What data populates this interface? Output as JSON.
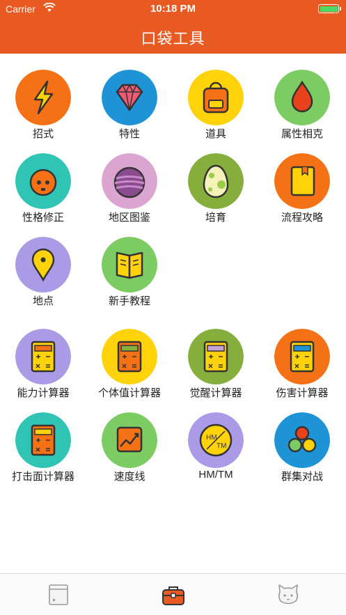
{
  "status_bar": {
    "carrier": "Carrier",
    "time": "10:18 PM"
  },
  "header": {
    "title": "口袋工具"
  },
  "grid": [
    {
      "label": "招式",
      "icon": "lightning-icon",
      "color": "#f57115"
    },
    {
      "label": "特性",
      "icon": "gem-icon",
      "color": "#1e94d6"
    },
    {
      "label": "道具",
      "icon": "backpack-icon",
      "color": "#ffd20a"
    },
    {
      "label": "属性相克",
      "icon": "drop-icon",
      "color": "#7ccb63"
    },
    {
      "label": "性格修正",
      "icon": "face-icon",
      "color": "#30c4b5"
    },
    {
      "label": "地区图鉴",
      "icon": "planet-icon",
      "color": "#dba5d2"
    },
    {
      "label": "培育",
      "icon": "egg-icon",
      "color": "#86ae3c"
    },
    {
      "label": "流程攻略",
      "icon": "book-icon",
      "color": "#f57115"
    },
    {
      "label": "地点",
      "icon": "pin-icon",
      "color": "#ab9be6"
    },
    {
      "label": "新手教程",
      "icon": "open-book-icon",
      "color": "#7ccb63"
    },
    {
      "label": "能力计算器",
      "icon": "calculator-icon",
      "color": "#ab9be6"
    },
    {
      "label": "个体值计算器",
      "icon": "calculator-icon",
      "color": "#ffd20a"
    },
    {
      "label": "觉醒计算器",
      "icon": "calculator-icon",
      "color": "#86ae3c"
    },
    {
      "label": "伤害计算器",
      "icon": "calculator-icon",
      "color": "#f57115"
    },
    {
      "label": "打击面计算器",
      "icon": "calculator-icon",
      "color": "#30c4b5"
    },
    {
      "label": "速度线",
      "icon": "chart-icon",
      "color": "#7ccb63"
    },
    {
      "label": "HM/TM",
      "icon": "disc-icon",
      "color": "#ab9be6",
      "disc_text_top": "HM",
      "disc_text_bottom": "TM"
    },
    {
      "label": "群集对战",
      "icon": "balls-icon",
      "color": "#1e94d6"
    }
  ],
  "tabbar": [
    {
      "icon": "browser-icon",
      "active": false
    },
    {
      "icon": "toolbox-icon",
      "active": true
    },
    {
      "icon": "cat-face-icon",
      "active": false
    }
  ]
}
